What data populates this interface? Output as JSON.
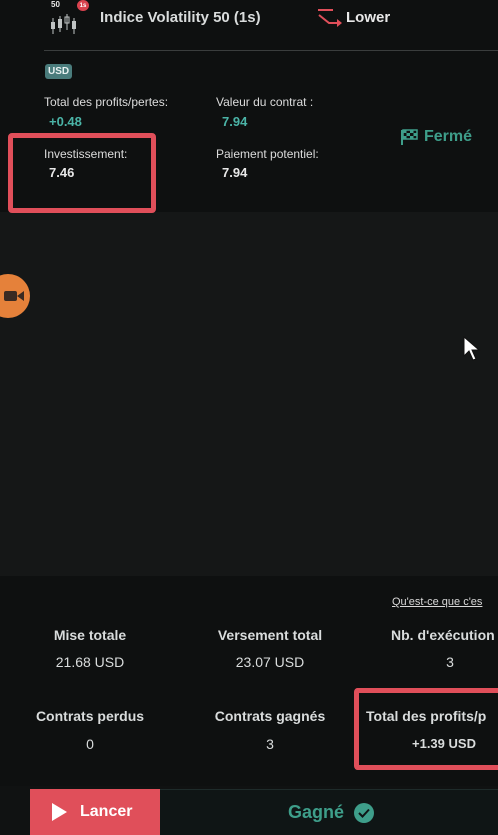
{
  "contract": {
    "badge_50": "50",
    "badge_1s": "1s",
    "asset_name": "Indice Volatility 50 (1s)",
    "direction": "Lower",
    "currency": "USD",
    "total_pnl_label": "Total des profits/pertes:",
    "total_pnl_value": "+0.48",
    "contract_value_label": "Valeur du contrat :",
    "contract_value": "7.94",
    "investment_label": "Investissement:",
    "investment_value": "7.46",
    "potential_payout_label": "Paiement potentiel:",
    "potential_payout_value": "7.94",
    "status": "Fermé"
  },
  "stats": {
    "help_link": "Qu'est-ce que c'es",
    "total_stake_label": "Mise totale",
    "total_stake_value": "21.68 USD",
    "total_payout_label": "Versement total",
    "total_payout_value": "23.07 USD",
    "runs_label": "Nb. d'exécution",
    "runs_value": "3",
    "lost_label": "Contrats perdus",
    "lost_value": "0",
    "won_label": "Contrats gagnés",
    "won_value": "3",
    "total_pnl_label": "Total des profits/p",
    "total_pnl_value": "+1.39 USD"
  },
  "bottom": {
    "launch_label": "Lancer",
    "result_label": "Gagné"
  },
  "colors": {
    "profit_green": "#4bb4a7",
    "highlight_red": "#e04f5a",
    "status_green": "#3e9e8a"
  },
  "icons": [
    "candlestick-chart-icon",
    "lower-arrow-icon",
    "checkered-flag-icon",
    "video-camera-icon",
    "play-icon",
    "check-circle-icon",
    "mouse-cursor-icon"
  ]
}
